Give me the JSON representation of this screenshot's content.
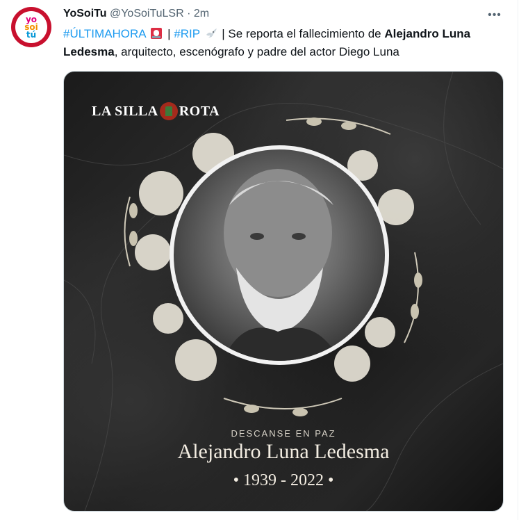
{
  "tweet": {
    "display_name": "YoSoiTu",
    "handle": "@YoSoiTuLSR",
    "separator": "·",
    "time": "2m",
    "more_label": "•••",
    "avatar_lines": [
      "yo",
      "soi",
      "tú"
    ],
    "text_parts": {
      "hashtag1": "#ÚLTIMAHORA",
      "sep1": " | ",
      "hashtag2": "#RIP",
      "sep2": " | Se reporta el fallecimiento de ",
      "bold_name": "Alejandro Luna Ledesma",
      "rest": ", arquitecto, escenógrafo y padre del actor Diego Luna"
    },
    "emoji": [
      "rotating-light-icon",
      "dove-icon"
    ]
  },
  "media": {
    "brand_left": "LA SILLA",
    "brand_right": "ROTA",
    "caption_top": "DESCANSE EN PAZ",
    "caption_name": "Alejandro Luna Ledesma",
    "caption_years": "• 1939 - 2022 •"
  },
  "colors": {
    "link": "#1d9bf0",
    "text": "#0f1419",
    "muted": "#536471",
    "avatar_ring": "#c8102e"
  }
}
